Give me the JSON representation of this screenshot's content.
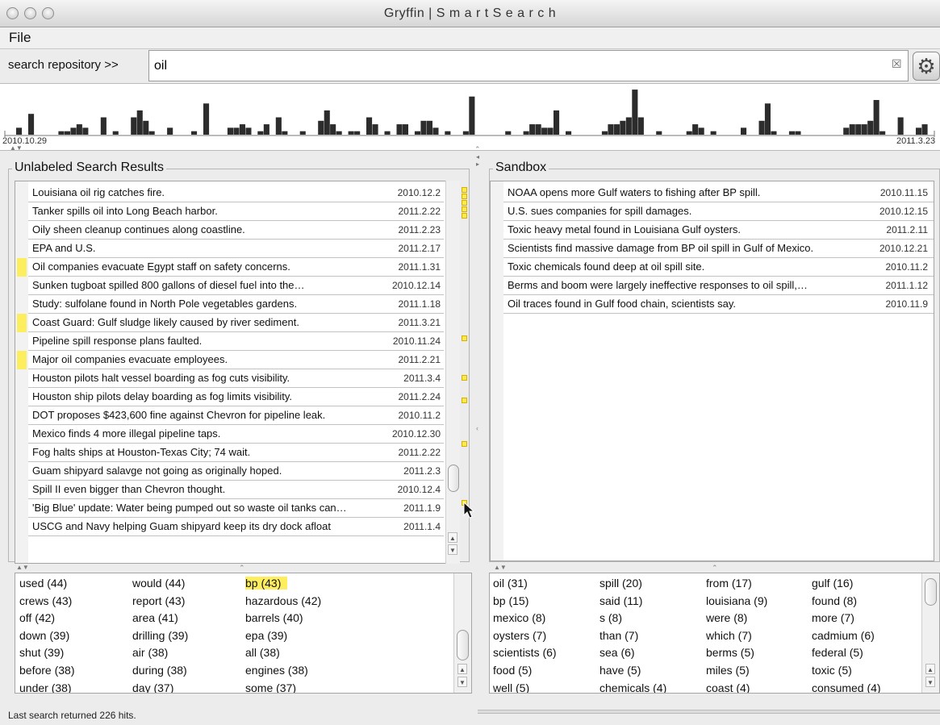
{
  "window": {
    "title": "Gryffin | S m a r t S e a r c h"
  },
  "menu": {
    "file": "File"
  },
  "search": {
    "label": "search repository >>",
    "value": "oil"
  },
  "icons": {
    "clear": "clear-x-icon",
    "settings": "gear-icon"
  },
  "timeline": {
    "start_label": "2010.10.29",
    "end_label": "2011.3.23",
    "histogram": [
      2,
      0,
      6,
      0,
      0,
      0,
      0,
      1,
      1,
      2,
      3,
      2,
      0,
      0,
      5,
      0,
      1,
      0,
      0,
      5,
      7,
      4,
      1,
      0,
      0,
      2,
      0,
      0,
      0,
      1,
      0,
      9,
      0,
      0,
      0,
      2,
      2,
      3,
      2,
      0,
      1,
      3,
      0,
      5,
      1,
      0,
      0,
      1,
      0,
      0,
      4,
      7,
      3,
      1,
      0,
      1,
      1,
      0,
      5,
      3,
      0,
      1,
      0,
      3,
      3,
      0,
      1,
      4,
      4,
      2,
      0,
      1,
      0,
      0,
      1,
      11,
      0,
      0,
      0,
      0,
      0,
      1,
      0,
      0,
      1,
      3,
      3,
      2,
      2,
      7,
      0,
      1,
      0,
      0,
      0,
      0,
      0,
      1,
      3,
      3,
      4,
      5,
      13,
      5,
      0,
      0,
      1,
      0,
      0,
      0,
      0,
      1,
      3,
      2,
      0,
      1,
      0,
      0,
      0,
      0,
      2,
      0,
      0,
      4,
      9,
      1,
      0,
      0,
      1,
      1,
      0,
      0,
      0,
      0,
      0,
      0,
      0,
      2,
      3,
      3,
      3,
      4,
      10,
      1,
      0,
      0,
      5,
      0,
      0,
      2,
      3
    ]
  },
  "left": {
    "title": "Unlabeled Search Results",
    "results": [
      {
        "title": "Louisiana oil rig catches fire.",
        "date": "2010.12.2",
        "labeled": false
      },
      {
        "title": "Tanker spills oil into Long Beach harbor.",
        "date": "2011.2.22",
        "labeled": false
      },
      {
        "title": "Oily sheen cleanup continues along coastline.",
        "date": "2011.2.23",
        "labeled": false
      },
      {
        "title": "EPA and U.S.",
        "date": "2011.2.17",
        "labeled": false
      },
      {
        "title": "Oil companies evacuate Egypt staff on safety concerns.",
        "date": "2011.1.31",
        "labeled": true
      },
      {
        "title": "Sunken tugboat spilled 800 gallons of diesel fuel into the…",
        "date": "2010.12.14",
        "labeled": false
      },
      {
        "title": "Study: sulfolane found in North Pole vegetables gardens.",
        "date": "2011.1.18",
        "labeled": false
      },
      {
        "title": "Coast Guard: Gulf sludge likely caused by river sediment.",
        "date": "2011.3.21",
        "labeled": true
      },
      {
        "title": "Pipeline spill response plans faulted.",
        "date": "2010.11.24",
        "labeled": false
      },
      {
        "title": "Major oil companies evacuate employees.",
        "date": "2011.2.21",
        "labeled": true
      },
      {
        "title": "Houston pilots halt vessel boarding as fog cuts visibility.",
        "date": "2011.3.4",
        "labeled": false
      },
      {
        "title": "Houston ship pilots delay boarding as fog limits visibility.",
        "date": "2011.2.24",
        "labeled": false
      },
      {
        "title": "DOT proposes $423,600 fine against Chevron for pipeline leak.",
        "date": "2010.11.2",
        "labeled": false
      },
      {
        "title": "Mexico finds 4 more illegal pipeline taps.",
        "date": "2010.12.30",
        "labeled": false
      },
      {
        "title": "Fog halts ships at Houston-Texas City; 74 wait.",
        "date": "2011.2.22",
        "labeled": false
      },
      {
        "title": "Guam shipyard salavge not going as originally hoped.",
        "date": "2011.2.3",
        "labeled": false
      },
      {
        "title": "Spill II even bigger than Chevron thought.",
        "date": "2010.12.4",
        "labeled": false
      },
      {
        "title": "'Big Blue' update: Water being pumped out so waste oil tanks can…",
        "date": "2011.1.9",
        "labeled": false
      },
      {
        "title": "USCG and Navy helping Guam shipyard keep its dry dock afloat",
        "date": "2011.1.4",
        "labeled": false
      }
    ],
    "terms": [
      "used (44)",
      "would (44)",
      "bp (43)",
      "crews (43)",
      "report (43)",
      "hazardous (42)",
      "off (42)",
      "area (41)",
      "barrels (40)",
      "down (39)",
      "drilling (39)",
      "epa (39)",
      "shut (39)",
      "air (38)",
      "all (38)",
      "before (38)",
      "during (38)",
      "engines (38)",
      "under (38)",
      "day (37)",
      "some (37)"
    ],
    "highlighted_term": "bp (43)"
  },
  "right": {
    "title": "Sandbox",
    "results": [
      {
        "title": "NOAA opens more Gulf waters to fishing after BP spill.",
        "date": "2010.11.15"
      },
      {
        "title": "U.S. sues companies for spill damages.",
        "date": "2010.12.15"
      },
      {
        "title": "Toxic heavy metal found in Louisiana Gulf oysters.",
        "date": "2011.2.11"
      },
      {
        "title": "Scientists find massive damage from BP oil spill in Gulf of Mexico.",
        "date": "2010.12.21"
      },
      {
        "title": "Toxic chemicals found deep at oil spill site.",
        "date": "2010.11.2"
      },
      {
        "title": "Berms and boom were largely ineffective responses to oil spill,…",
        "date": "2011.1.12"
      },
      {
        "title": "Oil traces found in Gulf food chain, scientists say.",
        "date": "2010.11.9"
      }
    ],
    "terms": [
      "oil (31)",
      "spill (20)",
      "from (17)",
      "gulf (16)",
      "bp (15)",
      "said (11)",
      "louisiana (9)",
      "found (8)",
      "mexico (8)",
      "s (8)",
      "were (8)",
      "more (7)",
      "oysters (7)",
      "than (7)",
      "which (7)",
      "cadmium (6)",
      "scientists (6)",
      "sea (6)",
      "berms (5)",
      "federal (5)",
      "food (5)",
      "have (5)",
      "miles (5)",
      "toxic (5)",
      "well (5)",
      "chemicals (4)",
      "coast (4)",
      "consumed (4)"
    ]
  },
  "status": {
    "text": "Last search returned 226 hits."
  },
  "colors": {
    "label_highlight": "#fdee60"
  }
}
